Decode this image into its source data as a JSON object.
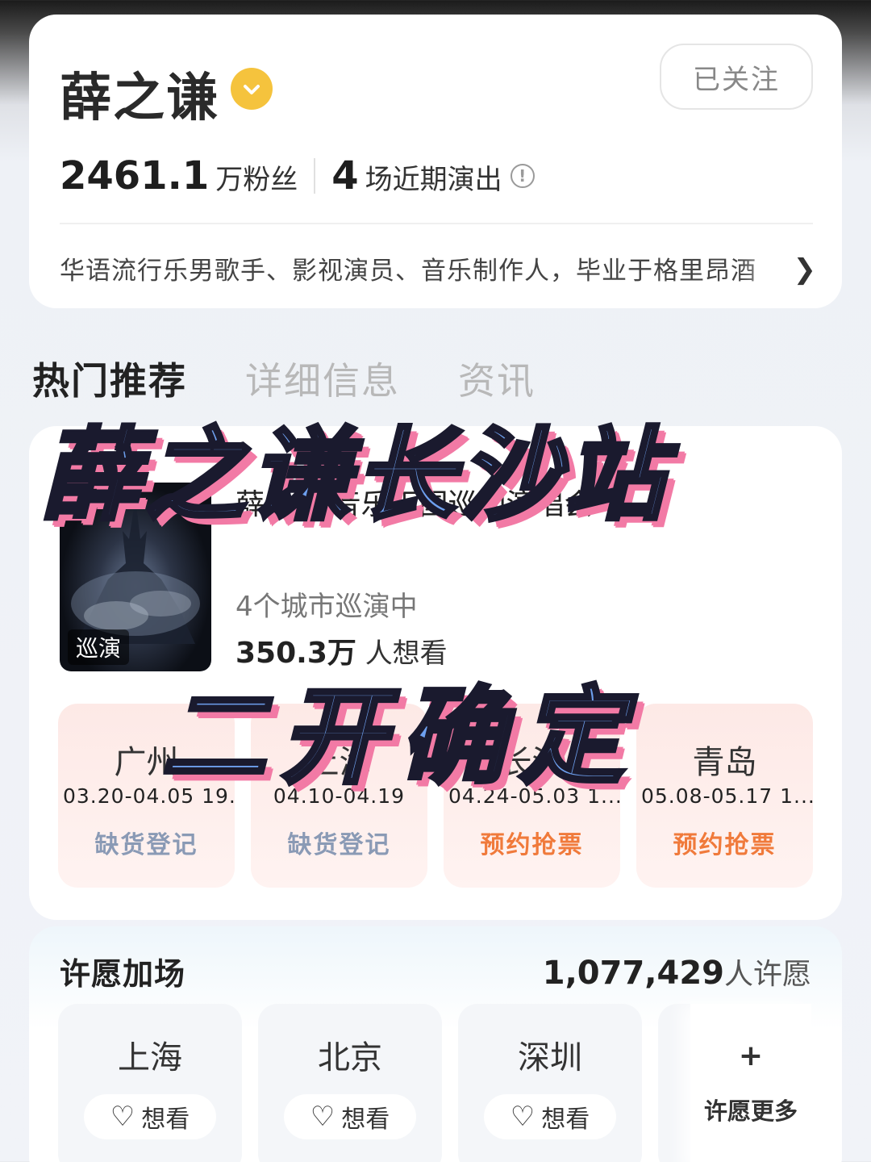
{
  "profile": {
    "name": "薛之谦",
    "follow_label": "已关注",
    "fans_number": "2461.1",
    "fans_label": "万粉丝",
    "shows_number": "4",
    "shows_label": "场近期演出",
    "bio": "华语流行乐男歌手、影视演员、音乐制作人，毕业于格里昂酒"
  },
  "tabs": [
    {
      "label": "热门推荐"
    },
    {
      "label": "详细信息"
    },
    {
      "label": "资讯"
    }
  ],
  "tour": {
    "poster_tag": "巡演",
    "title": "薛之谦 音乐王国巡回演唱会",
    "cities_status": "4个城市巡演中",
    "want_number": "350.3万",
    "want_label": "人想看",
    "cities": [
      {
        "name": "广州",
        "dates": "03.20-04.05 19...",
        "action": "缺货登记",
        "action_type": "waitlist"
      },
      {
        "name": "上海",
        "dates": "04.10-04.19",
        "action": "缺货登记",
        "action_type": "waitlist"
      },
      {
        "name": "长沙",
        "dates": "04.24-05.03  1...",
        "action": "预约抢票",
        "action_type": "reserve"
      },
      {
        "name": "青岛",
        "dates": "05.08-05.17  1...",
        "action": "预约抢票",
        "action_type": "reserve"
      }
    ]
  },
  "wish": {
    "title": "许愿加场",
    "count_number": "1,077,429",
    "count_label": "人许愿",
    "cities": [
      {
        "name": "上海",
        "button": "想看"
      },
      {
        "name": "北京",
        "button": "想看"
      },
      {
        "name": "深圳",
        "button": "想看"
      }
    ],
    "more_label": "许愿更多",
    "plus": "+"
  },
  "overlay": {
    "line1": "薛之谦长沙站",
    "line2": "二开确定"
  },
  "colors": {
    "reserve": "#f07a3b",
    "waitlist": "#8a9ab5",
    "verify": "#f5c33d",
    "overlay_fill": "#6ea0ef",
    "overlay_shadow": "#f27aa5"
  },
  "icons": [
    "verified-badge-icon",
    "info-icon",
    "chevron-right-icon",
    "heart-plus-icon",
    "plus-icon"
  ]
}
